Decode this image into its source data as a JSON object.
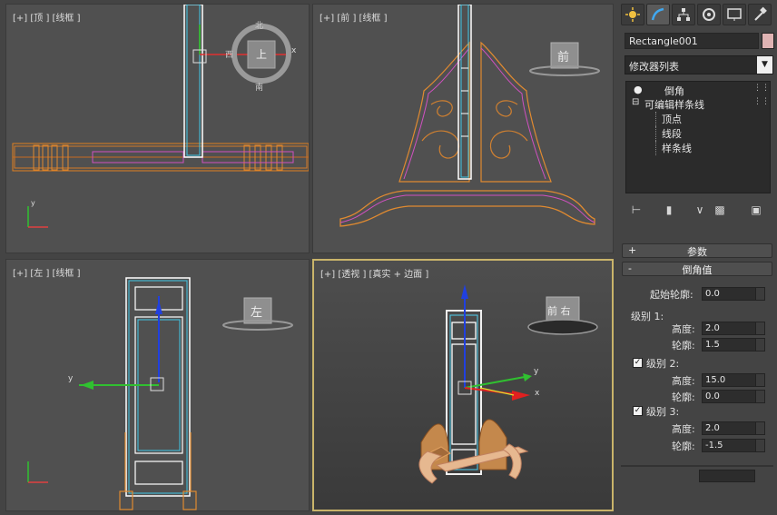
{
  "viewports": {
    "top": {
      "label": "[+] [顶 ] [线框 ]",
      "compass_n": "北",
      "compass_s": "南",
      "compass_w": "西",
      "cube": "上",
      "axis_x": "x",
      "axis_y": "y"
    },
    "front": {
      "label": "[+] [前 ] [线框 ]",
      "cube": "前"
    },
    "left": {
      "label": "[+] [左 ] [线框 ]",
      "cube": "左",
      "axis_y": "y"
    },
    "perspective": {
      "label": "[+] [透视 ] [真实 + 边面 ]",
      "cube": "前 右",
      "axis_x": "x",
      "axis_y": "y"
    }
  },
  "panel": {
    "object_name": "Rectangle001",
    "object_color": "#e0b4b4",
    "modifier_list": "修改器列表",
    "stack": [
      "倒角",
      "可编辑样条线",
      "顶点",
      "线段",
      "样条线"
    ],
    "rollouts": {
      "params": "参数",
      "bevel_values": "倒角值"
    },
    "start_outline_label": "起始轮廓:",
    "start_outline": "0.0",
    "level1": {
      "label": "级别 1:",
      "height_label": "高度:",
      "height": "2.0",
      "outline_label": "轮廓:",
      "outline": "1.5"
    },
    "level2": {
      "label": "级别 2:",
      "height_label": "高度:",
      "height": "15.0",
      "outline_label": "轮廓:",
      "outline": "0.0",
      "checked": true
    },
    "level3": {
      "label": "级别 3:",
      "height_label": "高度:",
      "height": "2.0",
      "outline_label": "轮廓:",
      "outline": "-1.5",
      "checked": true
    }
  }
}
